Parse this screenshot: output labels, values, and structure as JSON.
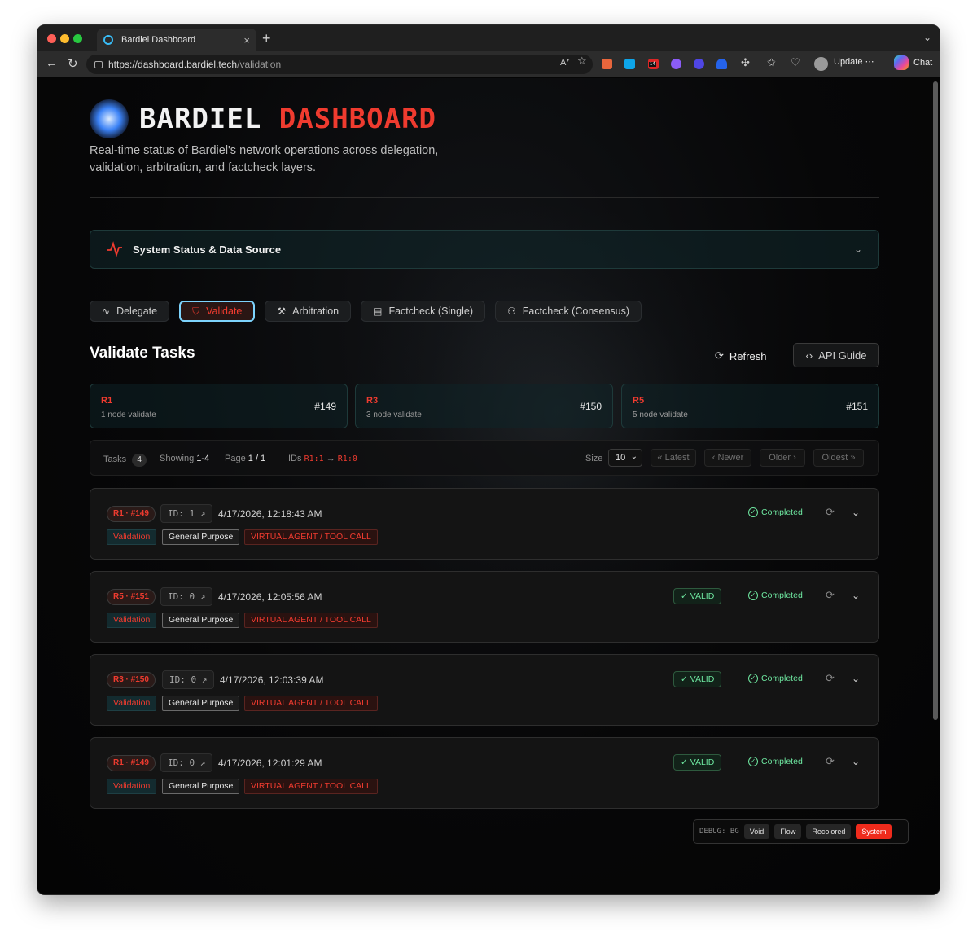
{
  "browser": {
    "tab_title": "Bardiel Dashboard",
    "url_host": "https://dashboard.bardiel.tech",
    "url_path": "/validation",
    "update_label": "Update",
    "chat_label": "Chat",
    "extension_badge": "14"
  },
  "header": {
    "brand_white": "BARDIEL",
    "brand_red": "DASHBOARD",
    "subtitle": "Real-time status of Bardiel's network operations across delegation, validation, arbitration, and factcheck layers."
  },
  "status_panel": {
    "title": "System Status & Data Source"
  },
  "nav_tabs": [
    {
      "label": "Delegate",
      "icon": "activity-icon",
      "active": false
    },
    {
      "label": "Validate",
      "icon": "shield-icon",
      "active": true
    },
    {
      "label": "Arbitration",
      "icon": "gavel-icon",
      "active": false
    },
    {
      "label": "Factcheck (Single)",
      "icon": "document-icon",
      "active": false
    },
    {
      "label": "Factcheck (Consensus)",
      "icon": "users-icon",
      "active": false
    }
  ],
  "section": {
    "title": "Validate Tasks",
    "refresh_label": "Refresh",
    "api_guide_label": "API Guide"
  },
  "round_cards": [
    {
      "label": "R1",
      "sub": "1 node validate",
      "num": "#149"
    },
    {
      "label": "R3",
      "sub": "3 node validate",
      "num": "#150"
    },
    {
      "label": "R5",
      "sub": "5 node validate",
      "num": "#151"
    }
  ],
  "filter": {
    "tasks_label": "Tasks",
    "tasks_count": "4",
    "showing_label": "Showing",
    "showing_value": "1-4",
    "page_label": "Page",
    "page_value": "1 / 1",
    "ids_label": "IDs",
    "ids_from": "R1:1",
    "ids_arrow": "→",
    "ids_to": "R1:0",
    "size_label": "Size",
    "size_value": "10",
    "latest": "« Latest",
    "newer": "‹ Newer",
    "older": "Older ›",
    "oldest": "Oldest »"
  },
  "tasks": [
    {
      "round": "R1 · #149",
      "id": "ID: 1",
      "time": "4/17/2026, 12:18:43 AM",
      "valid": "",
      "status": "Completed",
      "tags": [
        "Validation",
        "General Purpose",
        "VIRTUAL AGENT / TOOL CALL"
      ]
    },
    {
      "round": "R5 · #151",
      "id": "ID: 0",
      "time": "4/17/2026, 12:05:56 AM",
      "valid": "VALID",
      "status": "Completed",
      "tags": [
        "Validation",
        "General Purpose",
        "VIRTUAL AGENT / TOOL CALL"
      ]
    },
    {
      "round": "R3 · #150",
      "id": "ID: 0",
      "time": "4/17/2026, 12:03:39 AM",
      "valid": "VALID",
      "status": "Completed",
      "tags": [
        "Validation",
        "General Purpose",
        "VIRTUAL AGENT / TOOL CALL"
      ]
    },
    {
      "round": "R1 · #149",
      "id": "ID: 0",
      "time": "4/17/2026, 12:01:29 AM",
      "valid": "VALID",
      "status": "Completed",
      "tags": [
        "Validation",
        "General Purpose",
        "VIRTUAL AGENT / TOOL CALL"
      ]
    }
  ],
  "debug": {
    "label": "DEBUG: BG",
    "buttons": [
      "Void",
      "Flow",
      "Recolored",
      "System"
    ],
    "active": "System"
  },
  "colors": {
    "accent_red": "#ef3b2f",
    "accent_green": "#6ee7a0",
    "accent_cyan": "#7dd3fc"
  }
}
